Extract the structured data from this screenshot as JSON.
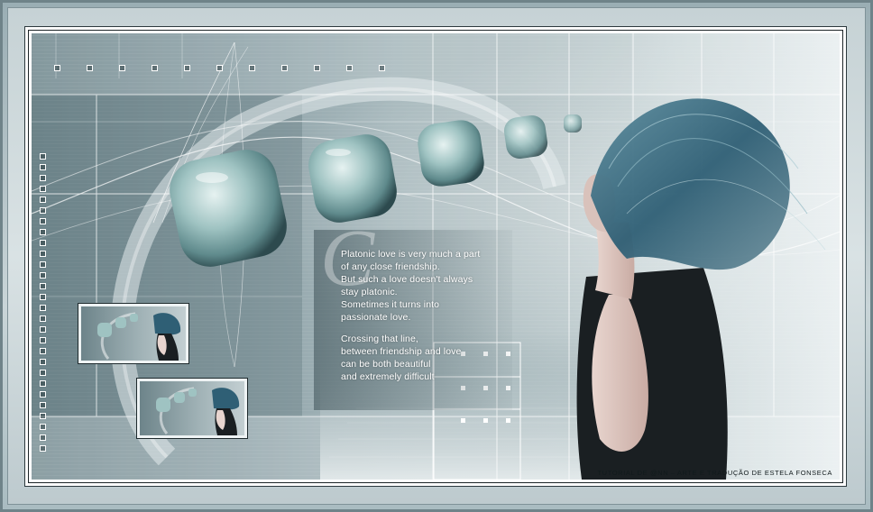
{
  "image": {
    "subject": "digital collage artwork",
    "dominant_colors": [
      "#738a90",
      "#a8b9bd",
      "#d3dcde",
      "#3e6e7c",
      "#ffffff"
    ]
  },
  "poem": {
    "initial_letter": "C",
    "stanza_1": [
      "Platonic love is very much a part",
      "of any close friendship.",
      "But such a love doesn't always",
      "stay platonic.",
      "Sometimes it turns into",
      "passionate love."
    ],
    "stanza_2": [
      "Crossing that line,",
      "between friendship and love",
      "can be both beautiful",
      "and extremely difficult"
    ]
  },
  "credit": "Tutorial de @nn – Arte e Tradução de Estela Fonseca",
  "icons": {
    "orb": "rounded-square-glass-orb-icon",
    "small_square": "small-square-frame-icon"
  }
}
